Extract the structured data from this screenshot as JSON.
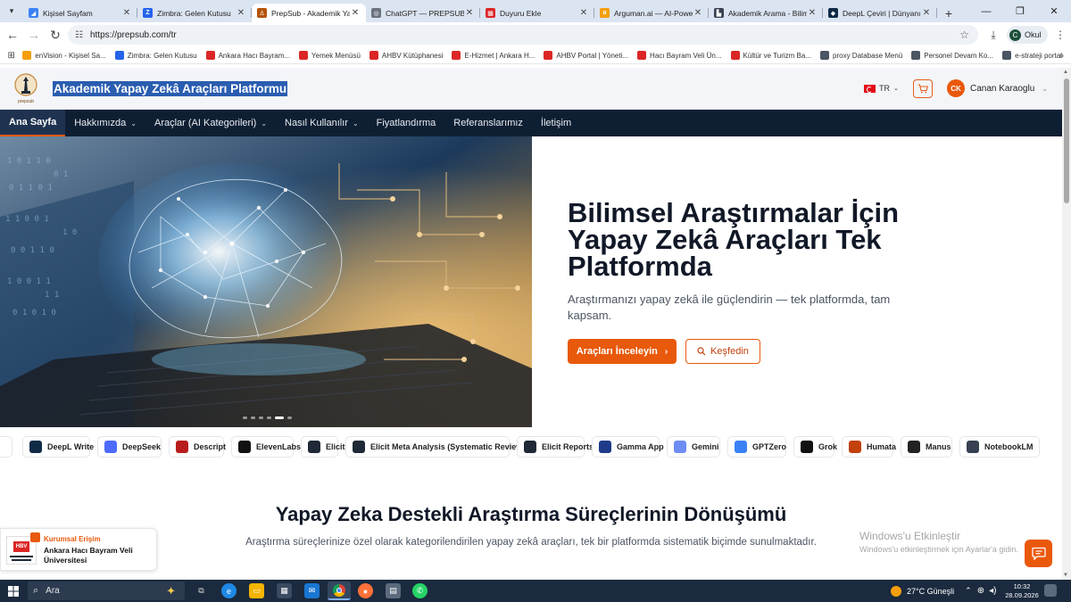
{
  "browser": {
    "tabs": [
      {
        "title": "Kişisel Sayfam",
        "color": "#3b82f6",
        "glyph": "◢"
      },
      {
        "title": "Zimbra: Gelen Kutusu",
        "color": "#2563eb",
        "glyph": "Z"
      },
      {
        "title": "PrepSub - Akademik Yapay Zekâ...",
        "color": "#b45309",
        "glyph": "♙",
        "active": true
      },
      {
        "title": "ChatGPT — PREPSUB",
        "color": "#6b7280",
        "glyph": "◎"
      },
      {
        "title": "Duyuru Ekle",
        "color": "#dc2626",
        "glyph": "▦"
      },
      {
        "title": "Arguman.ai — AI-Powered...",
        "color": "#f59e0b",
        "glyph": "a"
      },
      {
        "title": "Akademik Arama - Bilimsel...",
        "color": "#374151",
        "glyph": "▙"
      },
      {
        "title": "DeepL Çeviri | Dünyanın en...",
        "color": "#0f2b46",
        "glyph": "◆"
      }
    ],
    "new_tab_label": "+",
    "url": "https://prepsub.com/tr",
    "profile_initial": "C",
    "profile_label": "Okul",
    "bookmarks": [
      {
        "label": "enVision - Kişisel Sa...",
        "color": "#f59e0b"
      },
      {
        "label": "Zimbra: Gelen Kutusu",
        "color": "#2563eb"
      },
      {
        "label": "Ankara Hacı Bayram...",
        "color": "#dc2626"
      },
      {
        "label": "Yemek Menüsü",
        "color": "#dc2626"
      },
      {
        "label": "AHBV Kütüphanesi",
        "color": "#dc2626"
      },
      {
        "label": "E-Hizmet | Ankara H...",
        "color": "#dc2626"
      },
      {
        "label": "AHBV Portal | Yöneti...",
        "color": "#dc2626"
      },
      {
        "label": "Hacı Bayram Veli Ün...",
        "color": "#dc2626"
      },
      {
        "label": "Kültür ve Turizm Ba...",
        "color": "#dc2626"
      },
      {
        "label": "proxy Database Menü",
        "color": "#4b5563"
      },
      {
        "label": "Personel Devam Ko...",
        "color": "#4b5563"
      },
      {
        "label": "e-strateji portal",
        "color": "#4b5563"
      }
    ]
  },
  "header": {
    "logo_text": "prepsub",
    "title": "Akademik Yapay Zekâ Araçları Platformu",
    "lang": "TR",
    "user_initials": "CK",
    "user_name": "Canan Karaoglu"
  },
  "nav": [
    {
      "label": "Ana Sayfa",
      "active": true
    },
    {
      "label": "Hakkımızda",
      "dropdown": true
    },
    {
      "label": "Araçlar (AI Kategorileri)",
      "dropdown": true
    },
    {
      "label": "Nasıl Kullanılır",
      "dropdown": true
    },
    {
      "label": "Fiyatlandırma"
    },
    {
      "label": "Referanslarımız"
    },
    {
      "label": "İletişim"
    }
  ],
  "hero": {
    "title": "Bilimsel Araştırmalar İçin Yapay Zekâ Araçları Tek Platformda",
    "subtitle": "Araştırmanızı yapay zekâ ile güçlendirin — tek platformda, tam kapsam.",
    "primary_button": "Araçları İnceleyin",
    "secondary_button": "Keşfedin",
    "slide_count": 6,
    "active_slide": 4
  },
  "tools": [
    {
      "name": "DeepL Write",
      "color": "#0f2b46"
    },
    {
      "name": "DeepSeek",
      "color": "#4d6bfe"
    },
    {
      "name": "Descript",
      "color": "#b91c1c"
    },
    {
      "name": "ElevenLabs",
      "color": "#111111"
    },
    {
      "name": "Elicit",
      "color": "#1f2937"
    },
    {
      "name": "Elicit Meta Analysis (Systematic Review)",
      "color": "#1f2937"
    },
    {
      "name": "Elicit Reports",
      "color": "#1f2937"
    },
    {
      "name": "Gamma App",
      "color": "#1e3a8a"
    },
    {
      "name": "Gemini",
      "color": "#6d8df5"
    },
    {
      "name": "GPTZero",
      "color": "#3b82f6"
    },
    {
      "name": "Grok",
      "color": "#111111"
    },
    {
      "name": "Humata",
      "color": "#c2410c"
    },
    {
      "name": "Manus",
      "color": "#222222"
    },
    {
      "name": "NotebookLM",
      "color": "#374151"
    }
  ],
  "section": {
    "title": "Yapay Zeka Destekli Araştırma Süreçlerinin Dönüşümü",
    "subtitle": "Araştırma süreçlerinize özel olarak kategorilendirilen yapay zekâ araçları, tek bir platformda sistematik biçimde sunulmaktadır."
  },
  "institution": {
    "label": "Kurumsal Erişim",
    "name": "Ankara Hacı Bayram Veli Üniversitesi",
    "logo_text": "HBV"
  },
  "watermark": {
    "line1": "Windows'u Etkinleştir",
    "line2": "Windows'u etkinleştirmek için Ayarlar'a gidin."
  },
  "taskbar": {
    "search_label": "Ara",
    "weather": "27°C  Güneşli",
    "time": "10:32",
    "date": "28.09.2026"
  }
}
